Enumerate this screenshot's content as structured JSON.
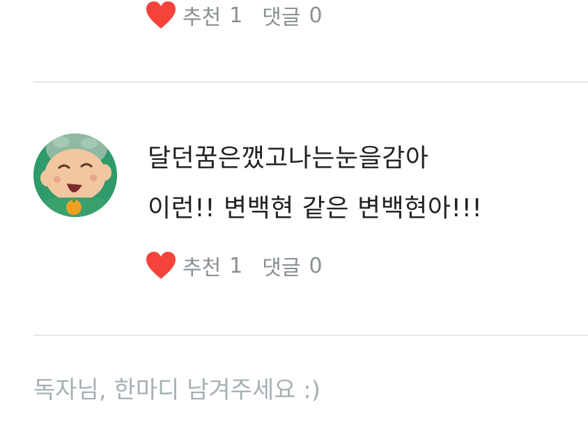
{
  "comments": [
    {
      "likes_label": "추천",
      "likes_count": "1",
      "replies_label": "댓글",
      "replies_count": "0"
    },
    {
      "lines": [
        "달던꿈은깼고나는눈을감아",
        "이런!! 변백현 같은 변백현아!!!"
      ],
      "likes_label": "추천",
      "likes_count": "1",
      "replies_label": "댓글",
      "replies_count": "0"
    }
  ],
  "input": {
    "placeholder": "독자님, 한마디 남겨주세요 :)"
  },
  "colors": {
    "heart": "#f4433b",
    "meta_text": "#8a8f93",
    "divider": "#e3e8ea",
    "placeholder": "#a7b0b4"
  },
  "icons": {
    "like": "heart-icon",
    "avatar": "cartoon-character-avatar"
  }
}
